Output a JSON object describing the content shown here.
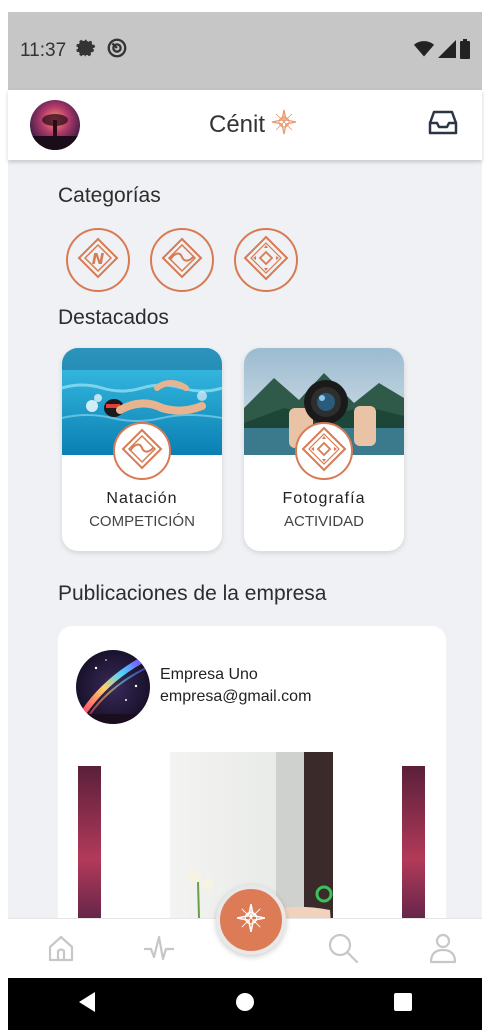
{
  "status_bar": {
    "time": "11:37"
  },
  "app_bar": {
    "title": "Cénit"
  },
  "sections": {
    "categories_title": "Categorías",
    "featured_title": "Destacados",
    "posts_title": "Publicaciones de la empresa"
  },
  "featured": [
    {
      "name": "Natación",
      "subtitle": "COMPETICIÓN"
    },
    {
      "name": "Fotografía",
      "subtitle": "ACTIVIDAD"
    }
  ],
  "post": {
    "company_name": "Empresa Uno",
    "email": "empresa@gmail.com"
  },
  "colors": {
    "accent": "#d87a52",
    "background": "#eff1f4",
    "status_bar": "#c6c6c6"
  },
  "icons": [
    "settings-icon",
    "focus-icon",
    "wifi-icon",
    "signal-icon",
    "battery-icon",
    "inbox-icon",
    "compass-icon",
    "home-icon",
    "activity-icon",
    "search-icon",
    "profile-icon"
  ]
}
